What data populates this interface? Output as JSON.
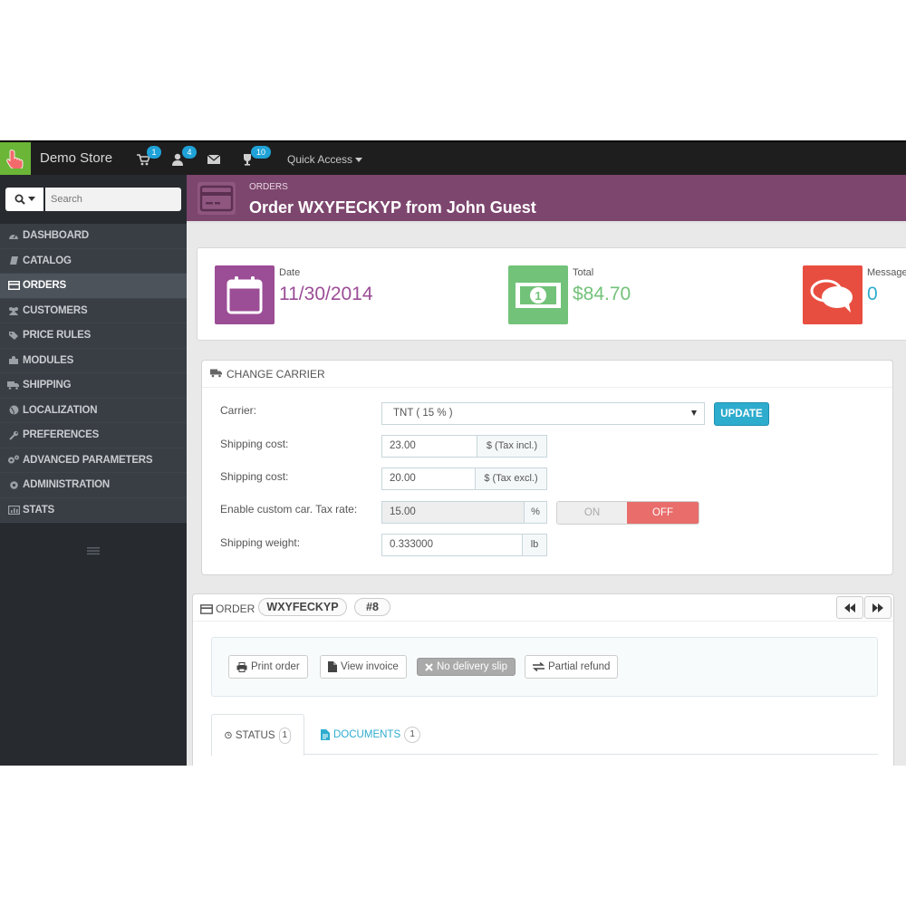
{
  "app": {
    "store_name": "Demo Store",
    "quick_access": "Quick Access",
    "badges": {
      "cart": "1",
      "customers": "4",
      "trophy": "10"
    }
  },
  "sidebar": {
    "search_placeholder": "Search",
    "items": [
      {
        "label": "DASHBOARD",
        "icon": "dashboard-icon"
      },
      {
        "label": "CATALOG",
        "icon": "book-icon"
      },
      {
        "label": "ORDERS",
        "icon": "credit-card-icon",
        "active": true
      },
      {
        "label": "CUSTOMERS",
        "icon": "users-icon"
      },
      {
        "label": "PRICE RULES",
        "icon": "tag-icon"
      },
      {
        "label": "MODULES",
        "icon": "puzzle-icon"
      },
      {
        "label": "SHIPPING",
        "icon": "truck-icon"
      },
      {
        "label": "LOCALIZATION",
        "icon": "globe-icon"
      },
      {
        "label": "PREFERENCES",
        "icon": "wrench-icon"
      },
      {
        "label": "ADVANCED PARAMETERS",
        "icon": "cogs-icon"
      },
      {
        "label": "ADMINISTRATION",
        "icon": "cog-icon"
      },
      {
        "label": "STATS",
        "icon": "bar-chart-icon"
      }
    ]
  },
  "header": {
    "breadcrumb": "ORDERS",
    "title": "Order WXYFECKYP from John Guest"
  },
  "kpi": {
    "date_label": "Date",
    "date_value": "11/30/2014",
    "total_label": "Total",
    "total_value": "$84.70",
    "messages_label": "Messages",
    "messages_value": "0"
  },
  "carrier": {
    "heading": "CHANGE CARRIER",
    "carrier_label": "Carrier:",
    "carrier_value": "TNT ( 15 % )",
    "update_label": "UPDATE",
    "shipping_incl_label": "Shipping cost:",
    "shipping_incl_value": "23.00",
    "shipping_incl_addon": "$ (Tax incl.)",
    "shipping_excl_label": "Shipping cost:",
    "shipping_excl_value": "20.00",
    "shipping_excl_addon": "$ (Tax excl.)",
    "tax_label": "Enable custom car. Tax rate:",
    "tax_value": "15.00",
    "tax_addon": "%",
    "toggle_on": "ON",
    "toggle_off": "OFF",
    "weight_label": "Shipping weight:",
    "weight_value": "0.333000",
    "weight_addon": "lb"
  },
  "order": {
    "label": "ORDER",
    "reference": "WXYFECKYP",
    "number": "#8",
    "actions": {
      "print": "Print order",
      "invoice": "View invoice",
      "delivery": "No delivery slip",
      "refund": "Partial refund"
    },
    "tabs": [
      {
        "label": "STATUS",
        "count": "1"
      },
      {
        "label": "DOCUMENTS",
        "count": "1"
      }
    ]
  },
  "colors": {
    "header_purple": "#7d466e",
    "date_purple": "#9b4d96",
    "total_green": "#72c279",
    "messages_red": "#e84e40",
    "link_blue": "#2eacce",
    "toggle_off": "#e86d6b"
  }
}
